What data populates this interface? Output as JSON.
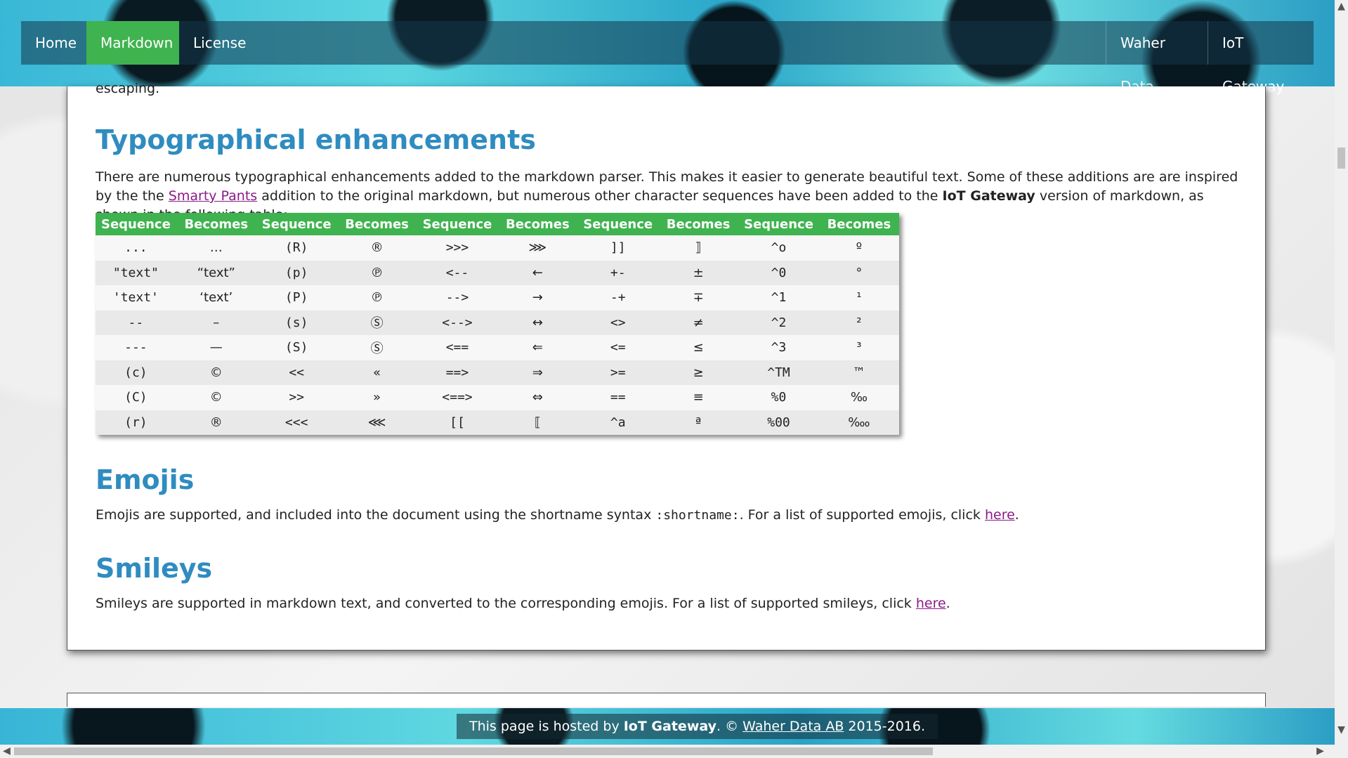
{
  "nav": {
    "left": [
      "Home",
      "Markdown",
      "License"
    ],
    "active": "Markdown",
    "right": [
      "Waher Data",
      "IoT Gateway"
    ]
  },
  "content": {
    "fragment": "escaping.",
    "typo_title": "Typographical enhancements",
    "typo_intro_1": "There are numerous typographical enhancements added to the markdown parser. This makes it easier to generate beautiful text. Some of these additions are are inspired by the the ",
    "typo_link": "Smarty Pants",
    "typo_intro_2": " addition to the original markdown, but numerous other character sequences have been added to the ",
    "typo_bold": "IoT Gateway",
    "typo_intro_3": " version of markdown, as shown in the following table:",
    "table_headers": [
      "Sequence",
      "Becomes",
      "Sequence",
      "Becomes",
      "Sequence",
      "Becomes",
      "Sequence",
      "Becomes",
      "Sequence",
      "Becomes"
    ],
    "table_rows": [
      [
        "...",
        "…",
        "(R)",
        "®",
        ">>>",
        "⋙",
        "]]",
        "⟧",
        "^o",
        "º"
      ],
      [
        "\"text\"",
        "“text”",
        "(p)",
        "℗",
        "<--",
        "←",
        "+-",
        "±",
        "^0",
        "°"
      ],
      [
        "'text'",
        "‘text’",
        "(P)",
        "℗",
        "-->",
        "→",
        "-+",
        "∓",
        "^1",
        "¹"
      ],
      [
        "--",
        "–",
        "(s)",
        "Ⓢ",
        "<-->",
        "↔",
        "<>",
        "≠",
        "^2",
        "²"
      ],
      [
        "---",
        "—",
        "(S)",
        "Ⓢ",
        "<==",
        "⇐",
        "<=",
        "≤",
        "^3",
        "³"
      ],
      [
        "(c)",
        "©",
        "<<",
        "«",
        "==>",
        "⇒",
        ">=",
        "≥",
        "^TM",
        "™"
      ],
      [
        "(C)",
        "©",
        ">>",
        "»",
        "<==>",
        "⇔",
        "==",
        "≡",
        "%0",
        "‰"
      ],
      [
        "(r)",
        "®",
        "<<<",
        "⋘",
        "[[",
        "⟦",
        "^a",
        "ª",
        "%00",
        "‱"
      ]
    ],
    "emojis_title": "Emojis",
    "emojis_text_1": "Emojis are supported, and included into the document using the shortname syntax ",
    "emojis_code": ":shortname:",
    "emojis_text_2": ". For a list of supported emojis, click ",
    "emojis_link": "here",
    "emojis_text_3": ".",
    "smileys_title": "Smileys",
    "smileys_text_1": "Smileys are supported in markdown text, and converted to the corresponding emojis. For a list of supported smileys, click ",
    "smileys_link": "here",
    "smileys_text_2": "."
  },
  "footer": {
    "text_1": "This page is hosted by ",
    "bold": "IoT Gateway",
    "text_2": ". © ",
    "link": "Waher Data AB",
    "text_3": " 2015-2016."
  },
  "colors": {
    "accent_green": "#3fb34f",
    "heading_blue": "#2f8cc0",
    "link_purple": "#8a1a8a"
  }
}
